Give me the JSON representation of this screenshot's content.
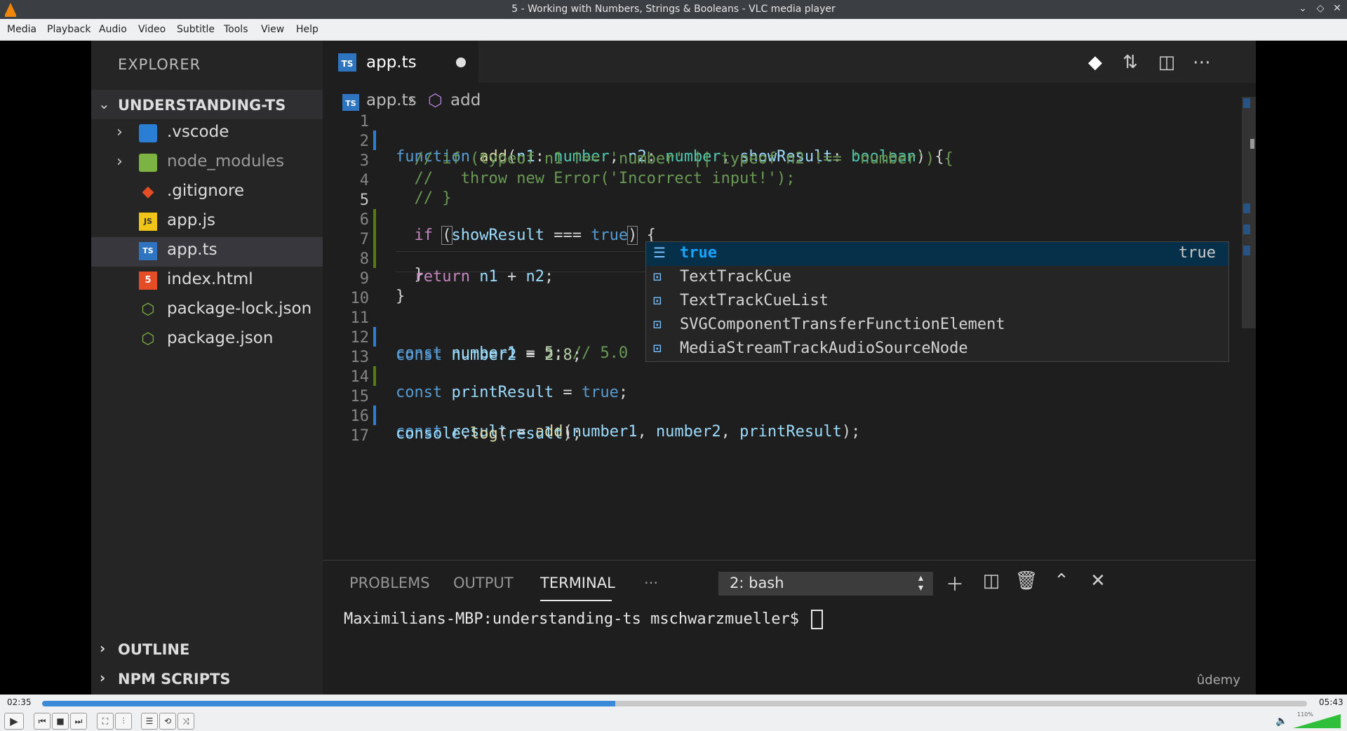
{
  "window": {
    "title": "5 - Working with Numbers, Strings & Booleans - VLC media player",
    "controls": [
      "⌄",
      "◇",
      "✕"
    ]
  },
  "menu": [
    "Media",
    "Playback",
    "Audio",
    "Video",
    "Subtitle",
    "Tools",
    "View",
    "Help"
  ],
  "explorer": {
    "title": "EXPLORER",
    "project": "UNDERSTANDING-TS",
    "items": [
      {
        "name": ".vscode",
        "icon": "folder-vscode-icon",
        "folder": true
      },
      {
        "name": "node_modules",
        "icon": "folder-node-icon",
        "folder": true
      },
      {
        "name": ".gitignore",
        "icon": "git-icon",
        "folder": false
      },
      {
        "name": "app.js",
        "icon": "js-file-icon",
        "folder": false,
        "badge": "JS"
      },
      {
        "name": "app.ts",
        "icon": "ts-file-icon",
        "folder": false,
        "badge": "TS",
        "selected": true
      },
      {
        "name": "index.html",
        "icon": "html-file-icon",
        "folder": false,
        "badge": "5"
      },
      {
        "name": "package-lock.json",
        "icon": "node-json-icon",
        "folder": false
      },
      {
        "name": "package.json",
        "icon": "node-json-icon",
        "folder": false
      }
    ],
    "sections": [
      "OUTLINE",
      "NPM SCRIPTS"
    ]
  },
  "editor": {
    "tab": {
      "name": "app.ts",
      "badge": "TS",
      "modified": true
    },
    "breadcrumb": [
      "app.ts",
      "add"
    ],
    "line_numbers": [
      "1",
      "2",
      "3",
      "4",
      "5",
      "6",
      "7",
      "8",
      "9",
      "10",
      "11",
      "12",
      "13",
      "14",
      "15",
      "16",
      "17"
    ]
  },
  "autocomplete": {
    "items": [
      {
        "label": "true",
        "detail": "true",
        "selected": true
      },
      {
        "label": "TextTrackCue",
        "detail": ""
      },
      {
        "label": "TextTrackCueList",
        "detail": ""
      },
      {
        "label": "SVGComponentTransferFunctionElement",
        "detail": ""
      },
      {
        "label": "MediaStreamTrackAudioSourceNode",
        "detail": ""
      }
    ]
  },
  "panel": {
    "tabs": [
      "PROBLEMS",
      "OUTPUT",
      "TERMINAL",
      "···"
    ],
    "active_tab": "TERMINAL",
    "terminal_select": "2: bash",
    "prompt": "Maximilians-MBP:understanding-ts mschwarzmueller$ ",
    "watermark": "ûdemy"
  },
  "player": {
    "elapsed": "02:35",
    "total": "05:43",
    "progress": 0.453,
    "volume_label": "110%",
    "volume_percent": 110
  },
  "colors": {
    "accent": "#3b8ad9",
    "vscode_bg": "#1e1e1e",
    "sidebar_bg": "#252526",
    "ts_blue": "#2f74c0"
  }
}
